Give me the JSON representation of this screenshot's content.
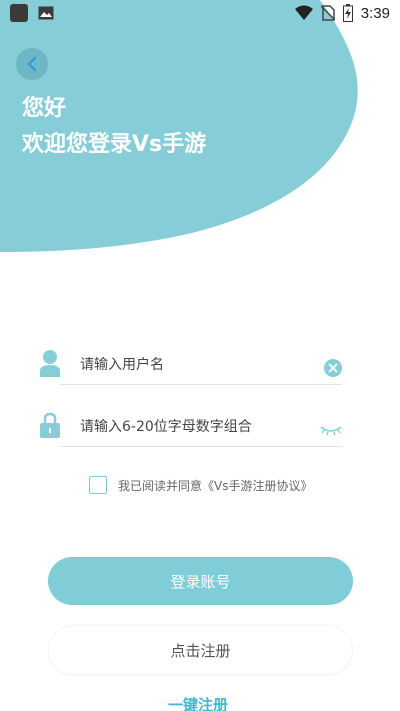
{
  "status_bar": {
    "time": "3:39",
    "icons": [
      "app-square-icon",
      "image-icon",
      "wifi-icon",
      "no-sim-icon",
      "battery-charging-icon"
    ]
  },
  "header": {
    "greeting": "您好",
    "welcome": "欢迎您登录Vs手游",
    "accent_color": "#86cdd8",
    "back_icon": "chevron-left-icon"
  },
  "form": {
    "username": {
      "placeholder": "请输入用户名",
      "icon": "user-icon",
      "action_icon": "clear-icon"
    },
    "password": {
      "placeholder": "请输入6-20位字母数字组合",
      "icon": "lock-icon",
      "action_icon": "eye-closed-icon"
    },
    "agreement": {
      "text": "我已阅读并同意《Vs手游注册协议》",
      "checked": false
    }
  },
  "buttons": {
    "login": "登录账号",
    "register": "点击注册",
    "one_click": "一键注册"
  },
  "colors": {
    "primary": "#80ccd7",
    "link": "#44b6d1"
  }
}
